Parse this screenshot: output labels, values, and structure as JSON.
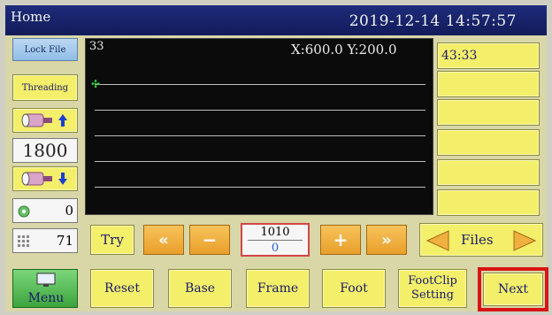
{
  "titlebar": {
    "title": "Home",
    "datetime": "2019-12-14 14:57:57"
  },
  "left": {
    "lock_file": "Lock File",
    "threading": "Threading",
    "speed": "1800",
    "bobbin_count": "0",
    "counter": "71"
  },
  "display": {
    "pattern_no": "33",
    "coords": "X:600.0 Y:200.0",
    "right_header": "43:33"
  },
  "stitch_panel": {
    "try": "Try",
    "stitch_no": "1010",
    "stitch_sub": "0",
    "files": "Files"
  },
  "bottom": {
    "menu": "Menu",
    "reset": "Reset",
    "base": "Base",
    "frame": "Frame",
    "foot": "Foot",
    "footclip_line1": "FootClip",
    "footclip_line2": "Setting",
    "next": "Next"
  },
  "colors": {
    "title_bar": "#1e2b7a",
    "button_yellow": "#f3ef6a",
    "arrow_orange": "#f0b040",
    "highlight_red": "#d81414"
  }
}
